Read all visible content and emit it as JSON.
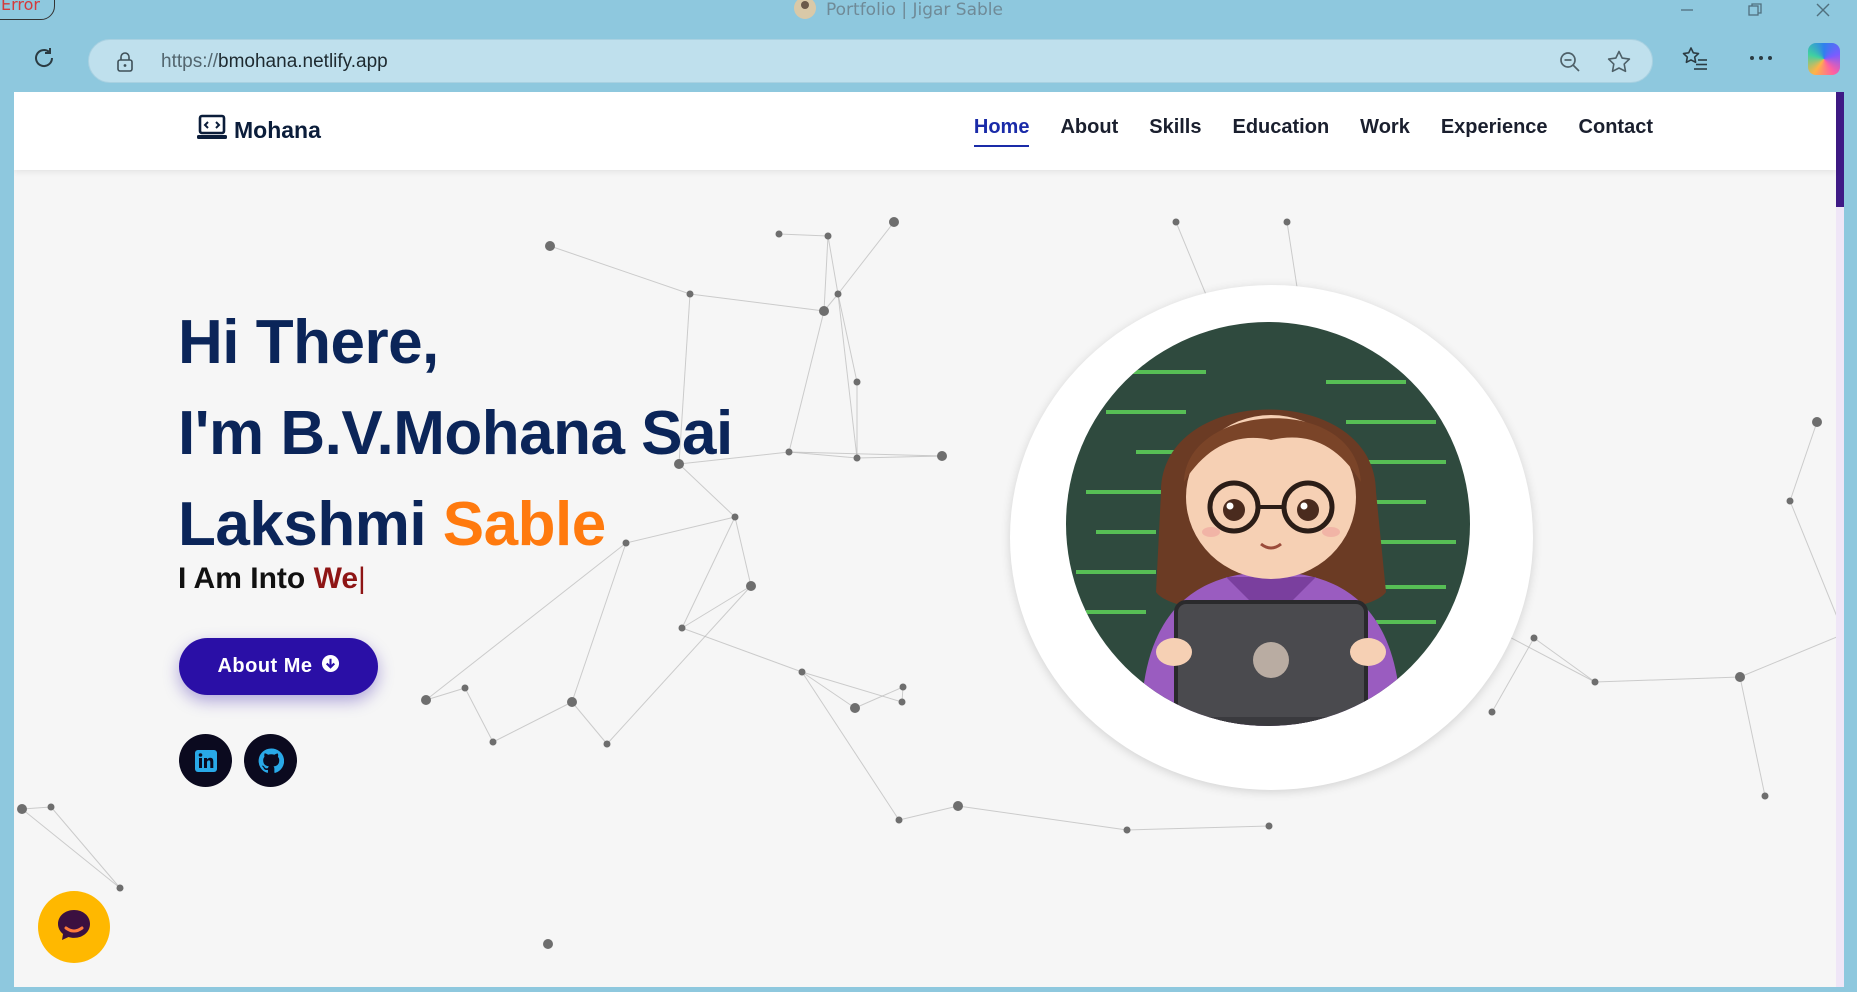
{
  "browser": {
    "error_badge": "Error",
    "tab_title": "Portfolio | Jigar Sable",
    "url_protocol": "https://",
    "url_host": "bmohana.netlify.app",
    "icons": [
      "reload-icon",
      "lock-icon",
      "zoom-out-icon",
      "favorite-star-icon",
      "favorites-list-icon",
      "more-icon",
      "copilot-icon",
      "minimize-icon",
      "restore-icon",
      "close-icon"
    ]
  },
  "navbar": {
    "logo_text": "Mohana",
    "links": [
      {
        "label": "Home",
        "active": true
      },
      {
        "label": "About",
        "active": false
      },
      {
        "label": "Skills",
        "active": false
      },
      {
        "label": "Education",
        "active": false
      },
      {
        "label": "Work",
        "active": false
      },
      {
        "label": "Experience",
        "active": false
      },
      {
        "label": "Contact",
        "active": false
      }
    ]
  },
  "hero": {
    "line1": "Hi There,",
    "line2": "I'm B.V.Mohana Sai",
    "line3_name": "Lakshmi",
    "line3_accent": "Sable",
    "typing_prefix": "I Am Into",
    "typing_word": "We",
    "typing_cursor": "|",
    "about_button_label": "About Me",
    "social_links": [
      "linkedin-icon",
      "github-icon"
    ]
  },
  "colors": {
    "heading": "#0b2559",
    "accent": "#ff7a0e",
    "typing": "#8e1515",
    "button": "#2a0fa6",
    "chat": "#ffb800"
  }
}
